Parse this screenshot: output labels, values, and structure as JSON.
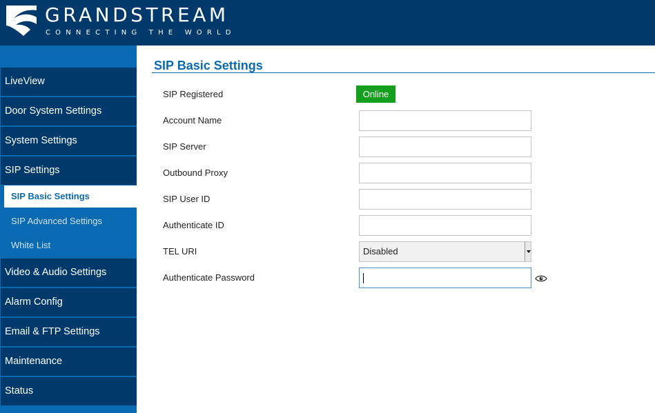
{
  "header": {
    "brand": "GRANDSTREAM",
    "tagline": "CONNECTING THE WORLD",
    "logo_icon": "grandstream-logo-icon"
  },
  "sidebar": {
    "items": [
      {
        "label": "LiveView"
      },
      {
        "label": "Door System Settings"
      },
      {
        "label": "System Settings"
      },
      {
        "label": "SIP Settings"
      },
      {
        "label": "SIP Basic Settings",
        "active": true
      },
      {
        "label": "SIP Advanced Settings"
      },
      {
        "label": "White List"
      },
      {
        "label": "Video & Audio Settings"
      },
      {
        "label": "Alarm Config"
      },
      {
        "label": "Email & FTP Settings"
      },
      {
        "label": "Maintenance"
      },
      {
        "label": "Status"
      }
    ]
  },
  "main": {
    "title": "SIP Basic Settings",
    "fields": {
      "sip_registered": {
        "label": "SIP Registered",
        "status": "Online",
        "status_color": "#14a01e"
      },
      "account_name": {
        "label": "Account Name",
        "value": ""
      },
      "sip_server": {
        "label": "SIP Server",
        "value": ""
      },
      "outbound_proxy": {
        "label": "Outbound Proxy",
        "value": ""
      },
      "sip_user_id": {
        "label": "SIP User ID",
        "value": ""
      },
      "authenticate_id": {
        "label": "Authenticate ID",
        "value": ""
      },
      "tel_uri": {
        "label": "TEL URI",
        "value": "Disabled"
      },
      "authenticate_password": {
        "label": "Authenticate Password",
        "value": "",
        "icon": "eye-icon"
      }
    }
  },
  "colors": {
    "header_bg": "#003a6c",
    "sidebar_bg": "#0a6ab1",
    "accent": "#0a6ab1",
    "online": "#14a01e"
  }
}
